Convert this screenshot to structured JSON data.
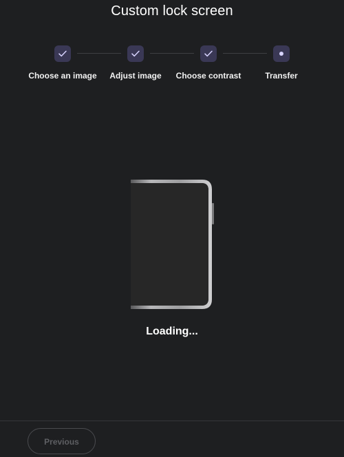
{
  "header": {
    "title": "Custom lock screen"
  },
  "stepper": {
    "steps": [
      {
        "label": "Choose an image",
        "state": "completed",
        "icon": "check-icon"
      },
      {
        "label": "Adjust image",
        "state": "completed",
        "icon": "check-icon"
      },
      {
        "label": "Choose contrast",
        "state": "completed",
        "icon": "check-icon"
      },
      {
        "label": "Transfer",
        "state": "current",
        "icon": "dot-icon"
      }
    ]
  },
  "main": {
    "status_text": "Loading...",
    "device_icon": "device-icon"
  },
  "footer": {
    "previous_label": "Previous",
    "previous_enabled": false
  },
  "colors": {
    "background": "#1e1f21",
    "step_badge": "#3a3855",
    "step_accent": "#d8d4ff",
    "disabled_text": "#5e5f63"
  }
}
